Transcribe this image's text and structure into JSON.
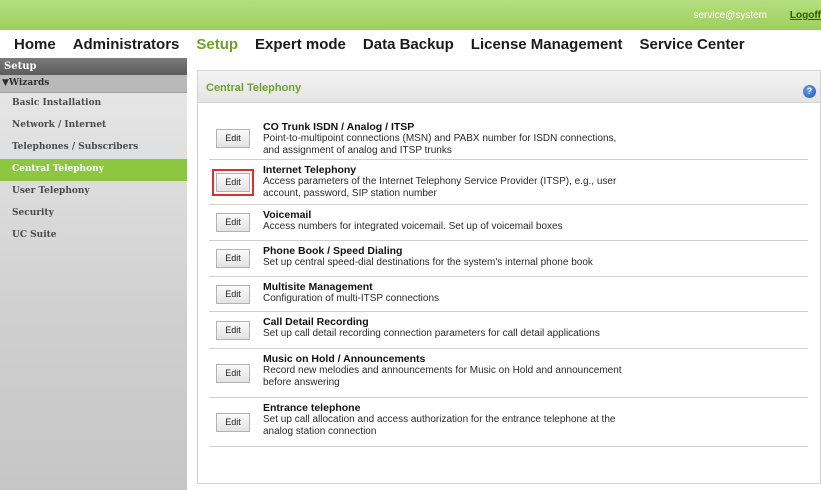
{
  "topbar": {
    "user": "service@system",
    "logoff": "Logoff"
  },
  "nav": {
    "items": [
      {
        "label": "Home"
      },
      {
        "label": "Administrators"
      },
      {
        "label": "Setup",
        "active": true
      },
      {
        "label": "Expert mode"
      },
      {
        "label": "Data Backup"
      },
      {
        "label": "License Management"
      },
      {
        "label": "Service Center"
      }
    ]
  },
  "sidebar": {
    "header": "Setup",
    "wizards_label": "▼Wizards",
    "items": [
      {
        "label": "Basic Installation"
      },
      {
        "label": "Network / Internet"
      },
      {
        "label": "Telephones / Subscribers"
      },
      {
        "label": "Central Telephony",
        "active": true
      },
      {
        "label": "User Telephony"
      },
      {
        "label": "Security"
      },
      {
        "label": "UC Suite"
      }
    ]
  },
  "panel": {
    "title": "Central Telephony",
    "help_icon": "help-icon",
    "help_glyph": "?"
  },
  "rows": [
    {
      "edit": "Edit",
      "title": "CO Trunk ISDN / Analog / ITSP",
      "desc": [
        "Point-to-multipoint connections (MSN) and PABX number for ISDN connections,",
        "and assignment of analog and ITSP trunks"
      ]
    },
    {
      "edit": "Edit",
      "title": "Internet Telephony",
      "desc": [
        "Access parameters of the Internet Telephony Service Provider (ITSP), e.g., user",
        "account, password, SIP station number"
      ],
      "highlight": true
    },
    {
      "edit": "Edit",
      "title": "Voicemail",
      "desc": [
        "Access numbers for integrated voicemail. Set up of voicemail boxes"
      ]
    },
    {
      "edit": "Edit",
      "title": "Phone Book / Speed Dialing",
      "desc": [
        "Set up central speed-dial destinations for the system's internal phone book"
      ]
    },
    {
      "edit": "Edit",
      "title": "Multisite Management",
      "desc": [
        "Configuration of multi-ITSP connections"
      ]
    },
    {
      "edit": "Edit",
      "title": "Call Detail Recording",
      "desc": [
        "Set up call detail recording connection parameters for call detail applications"
      ]
    },
    {
      "edit": "Edit",
      "title": "Music on Hold / Announcements",
      "desc": [
        "Record new melodies and announcements for Music on Hold and announcement",
        "before answering"
      ]
    },
    {
      "edit": "Edit",
      "title": "Entrance telephone",
      "desc": [
        "Set up call allocation and access authorization for the entrance telephone at the",
        "analog station connection"
      ]
    }
  ],
  "colors": {
    "accent": "#8dc63f",
    "highlight": "#d9322d"
  }
}
